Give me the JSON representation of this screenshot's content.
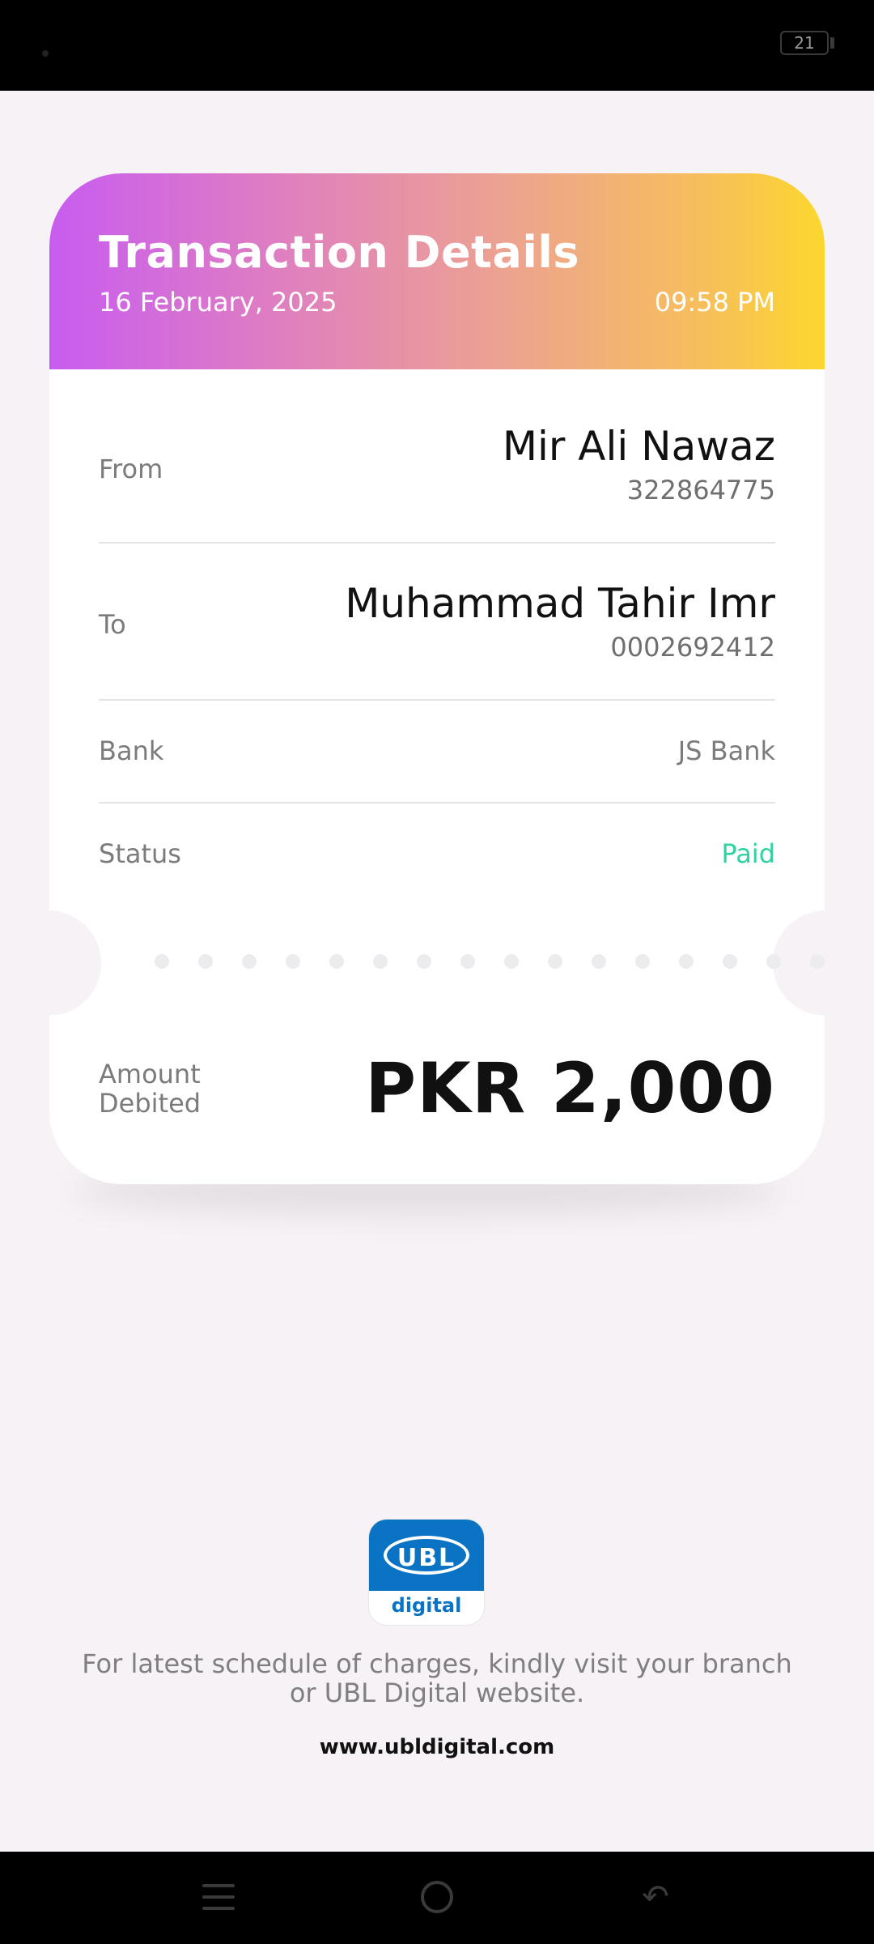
{
  "status_bar": {
    "battery": "21"
  },
  "card": {
    "title": "Transaction Details",
    "date": "16 February, 2025",
    "time": "09:58 PM",
    "from": {
      "label": "From",
      "name": "Mir Ali Nawaz",
      "account": "322864775"
    },
    "to": {
      "label": "To",
      "name": "Muhammad Tahir Imr",
      "account": "0002692412"
    },
    "bank": {
      "label": "Bank",
      "value": "JS Bank"
    },
    "status": {
      "label": "Status",
      "value": "Paid",
      "color": "#2ed3a0"
    },
    "amount": {
      "label_line1": "Amount",
      "label_line2": "Debited",
      "value": "PKR 2,000"
    }
  },
  "logo": {
    "text": "UBL",
    "sub": "digital",
    "brand_color": "#0a73c4"
  },
  "footer": {
    "note": "For latest schedule of charges, kindly visit your branch or UBL Digital website.",
    "link": "www.ubldigital.com"
  },
  "nav_bar": {
    "icons": [
      "menu-icon",
      "home-icon",
      "back-icon"
    ]
  }
}
